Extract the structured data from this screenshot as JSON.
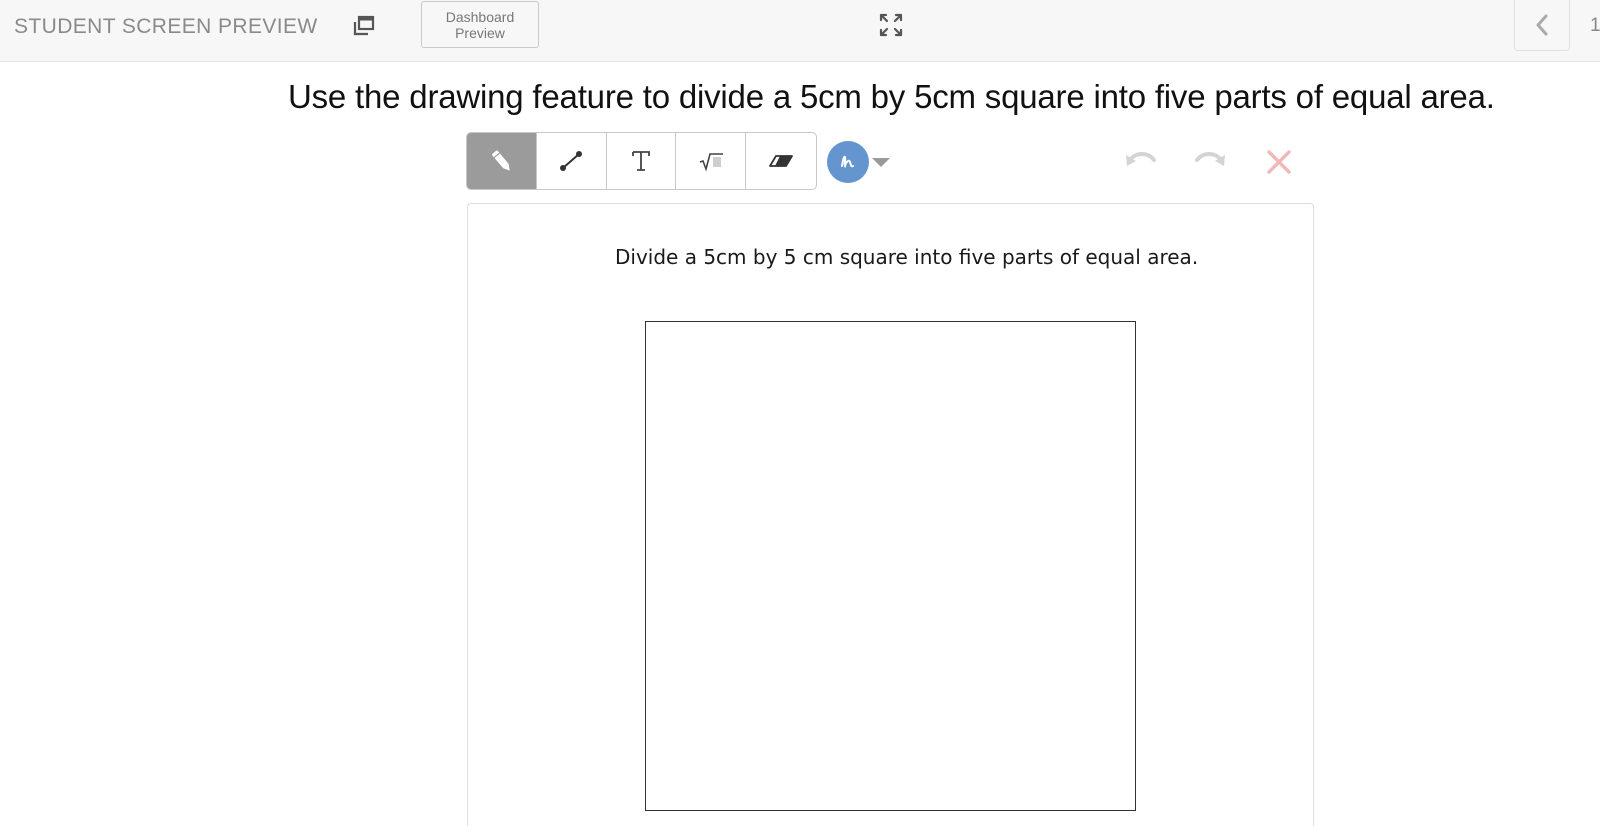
{
  "topbar": {
    "title": "STUDENT SCREEN PREVIEW",
    "popout_icon": "popout-window-icon",
    "dashboard_button": {
      "line1": "Dashboard",
      "line2": "Preview"
    },
    "fullscreen_icon": "fullscreen-expand-icon",
    "prev_icon": "chevron-left-icon",
    "page_number": "1"
  },
  "prompt": "Use the drawing feature to divide a 5cm by 5cm square into five parts of equal area.",
  "toolbar": {
    "tools": [
      {
        "name": "pencil",
        "icon": "pencil-icon",
        "active": true
      },
      {
        "name": "line",
        "icon": "line-segment-icon",
        "active": false
      },
      {
        "name": "text",
        "icon": "text-t-icon",
        "active": false
      },
      {
        "name": "math",
        "icon": "square-root-icon",
        "active": false
      },
      {
        "name": "eraser",
        "icon": "eraser-icon",
        "active": false
      }
    ],
    "color": "#6495cf",
    "undo_icon": "undo-arrow-icon",
    "redo_icon": "redo-arrow-icon",
    "clear_icon": "clear-x-icon"
  },
  "canvas": {
    "caption": "Divide a 5cm by 5 cm square into five parts of equal area."
  },
  "colors": {
    "active_tool_bg": "#9b9b9b",
    "clear_icon": "#f2b8b8",
    "undo_redo": "#d4d4d4"
  }
}
